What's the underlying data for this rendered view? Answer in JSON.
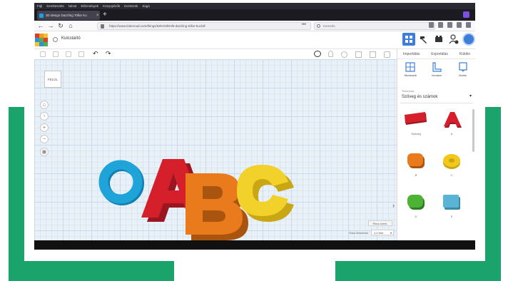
{
  "colors": {
    "frame": "#1aa36b",
    "accent": "#3d7ed8",
    "workplane": "#e9f1f8"
  },
  "browser": {
    "menu": [
      "Fájl",
      "Szerkesztés",
      "Nézet",
      "Előzmények",
      "Könyvjelzők",
      "Eszközök",
      "Súgó"
    ],
    "tab_title": "3D design Dazzling Trillor Ku",
    "tab_close": "×",
    "new_tab": "+",
    "url": "https://www.tinkercad.com/things/0ZKG0l0Hl0-dazzling-trillor-kucloll",
    "url_dots": "•••",
    "search_placeholder": "Keresés"
  },
  "app": {
    "design_name": "Kulcstartó",
    "panel_tabs": [
      "Importálás",
      "Exportálás",
      "Küldés"
    ],
    "panel_tools": [
      "Munkasík",
      "Vonalzó",
      "Notes"
    ],
    "library_category": "Tinkercad",
    "library_selected": "Szöveg és számok",
    "library_caret": "▾",
    "shapes": [
      {
        "label": "Szöveg",
        "icon": "text-3d-icon",
        "color": "#d51f2b"
      },
      {
        "label": "A",
        "icon": "letter-a-icon",
        "color": "#d51f2b"
      },
      {
        "label": "B",
        "icon": "letter-b-icon",
        "color": "#e97b1d"
      },
      {
        "label": "C",
        "icon": "letter-c-icon",
        "color": "#f2c81a"
      },
      {
        "label": "D",
        "icon": "letter-d-icon",
        "color": "#4db334"
      },
      {
        "label": "E",
        "icon": "letter-e-icon",
        "color": "#5ab4d6"
      }
    ],
    "viewcube_label": "FELÜL",
    "edit_grid": "Rács szerk.",
    "snap_label": "Rács illesztése",
    "snap_value": "1,0 mm",
    "snap_caret": "▾",
    "collapse_chevron": "›"
  },
  "scene": {
    "letters": [
      {
        "char": "A",
        "color": "#d51f2b"
      },
      {
        "char": "B",
        "color": "#e97b1d"
      },
      {
        "char": "C",
        "color": "#f2d12a"
      }
    ],
    "ring_color": "#1ea4d8"
  }
}
